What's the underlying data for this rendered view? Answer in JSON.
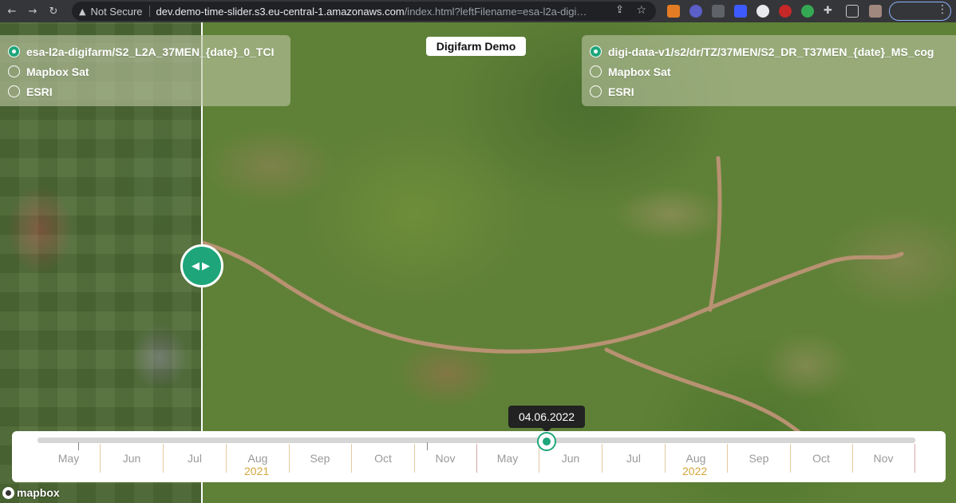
{
  "browser": {
    "not_secure_label": "Not Secure",
    "url_host": "dev.demo-time-slider.s3.eu-central-1.amazonaws.com",
    "url_rest": "/index.html?leftFilename=esa-l2a-digif..."
  },
  "app": {
    "title": "Digifarm Demo",
    "current_date": "04.06.2022"
  },
  "left_layers": [
    {
      "label": "esa-l2a-digifarm/S2_L2A_37MEN_{date}_0_TCI",
      "checked": true
    },
    {
      "label": "Mapbox Sat",
      "checked": false
    },
    {
      "label": "ESRI",
      "checked": false
    }
  ],
  "right_layers": [
    {
      "label": "digi-data-v1/s2/dr/TZ/37MEN/S2_DR_T37MEN_{date}_MS_cog",
      "checked": true
    },
    {
      "label": "Mapbox Sat",
      "checked": false
    },
    {
      "label": "ESRI",
      "checked": false
    }
  ],
  "timeline": {
    "months": [
      "May",
      "Jun",
      "Jul",
      "Aug",
      "Sep",
      "Oct",
      "Nov",
      "May",
      "Jun",
      "Jul",
      "Aug",
      "Sep",
      "Oct",
      "Nov"
    ],
    "years": [
      "2021",
      "2022"
    ]
  },
  "attribution": {
    "logo_text": "mapbox"
  },
  "colors": {
    "accent": "#1ea67a",
    "year_label": "#d4a73a"
  }
}
